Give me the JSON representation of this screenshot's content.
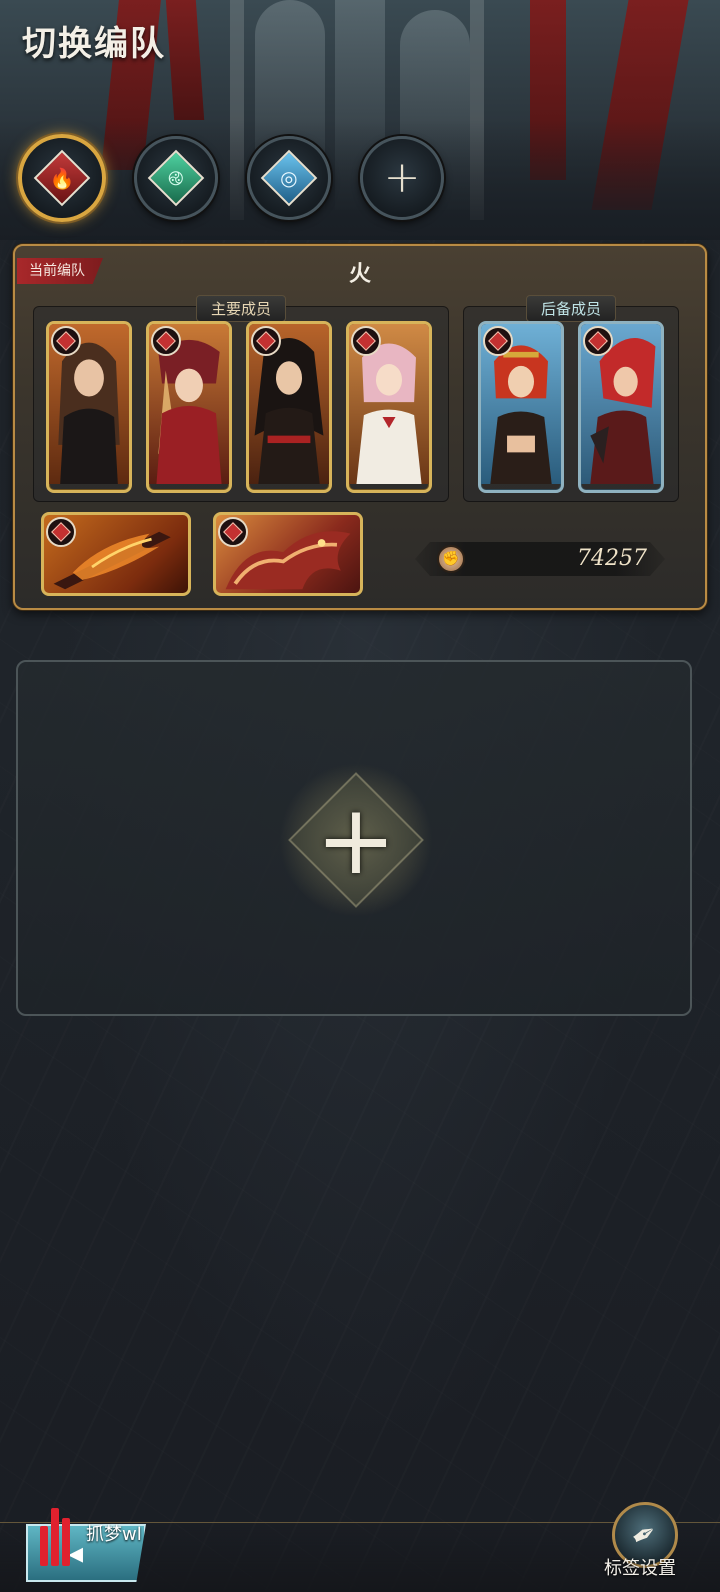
{
  "header": {
    "title": "切换编队"
  },
  "team_tabs": [
    {
      "name": "fire",
      "icon": "fire-element-icon",
      "color": "#c23a3a",
      "active": true
    },
    {
      "name": "wind",
      "icon": "wind-element-icon",
      "color": "#4ed1a0",
      "active": false
    },
    {
      "name": "water",
      "icon": "water-element-icon",
      "color": "#6bc3ee",
      "active": false
    },
    {
      "name": "add",
      "icon": "plus-icon",
      "active": false
    }
  ],
  "current_team": {
    "tag": "当前编队",
    "name": "火",
    "main_label": "主要成员",
    "reserve_label": "后备成员",
    "main_members": [
      {
        "portrait": "brown-hair-girl-black-dress",
        "element": "fire-element-icon"
      },
      {
        "portrait": "blonde-girl-red-hood",
        "element": "fire-element-icon"
      },
      {
        "portrait": "black-hair-woman-dark-outfit",
        "element": "fire-element-icon"
      },
      {
        "portrait": "pink-hair-girl-white-dress",
        "element": "fire-element-icon"
      }
    ],
    "reserve_members": [
      {
        "portrait": "red-hair-girl-gold-circlet",
        "element": "fire-element-icon"
      },
      {
        "portrait": "red-hair-girl-dark-armor",
        "element": "fire-element-icon"
      }
    ],
    "weapon": {
      "icon": "flame-sword-icon",
      "element": "fire-element-icon"
    },
    "summon": {
      "icon": "fire-dragon-icon",
      "element": "fire-element-icon"
    },
    "power": {
      "icon": "fist-icon",
      "value": "74257"
    }
  },
  "empty_slot": {
    "icon": "plus-icon"
  },
  "bottom_bar": {
    "back_icon": "back-arrow-icon",
    "watermark": "抓梦wl",
    "tag_settings_label": "标签设置",
    "tag_settings_icon": "feather-icon"
  },
  "colors": {
    "accent_gold": "#d9a640",
    "fire_red": "#c23a3a",
    "reserve_frame": "#8fb2c0"
  }
}
